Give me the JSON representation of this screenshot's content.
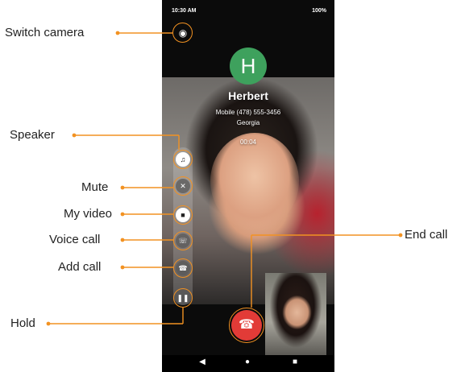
{
  "status": {
    "time": "10:30 AM",
    "right": "100%"
  },
  "caller": {
    "avatar_letter": "H",
    "name": "Herbert",
    "number": "Mobile (478) 555-3456",
    "location": "Georgia",
    "timer": "00:04"
  },
  "labels": {
    "switch_camera": "Switch camera",
    "speaker": "Speaker",
    "mute": "Mute",
    "my_video": "My video",
    "voice_call": "Voice call",
    "add_call": "Add call",
    "hold": "Hold",
    "end_call": "End call"
  },
  "icons": {
    "switch_camera": "camera-rotate-icon",
    "speaker": "speaker-icon",
    "mute": "microphone-off-icon",
    "my_video": "video-camera-icon",
    "voice_call": "voice-call-icon",
    "add_call": "add-call-icon",
    "hold": "pause-icon",
    "end_call": "phone-hangup-icon"
  },
  "colors": {
    "accent": "#f29222",
    "avatar": "#3ea15d",
    "end_call": "#e23b37"
  }
}
